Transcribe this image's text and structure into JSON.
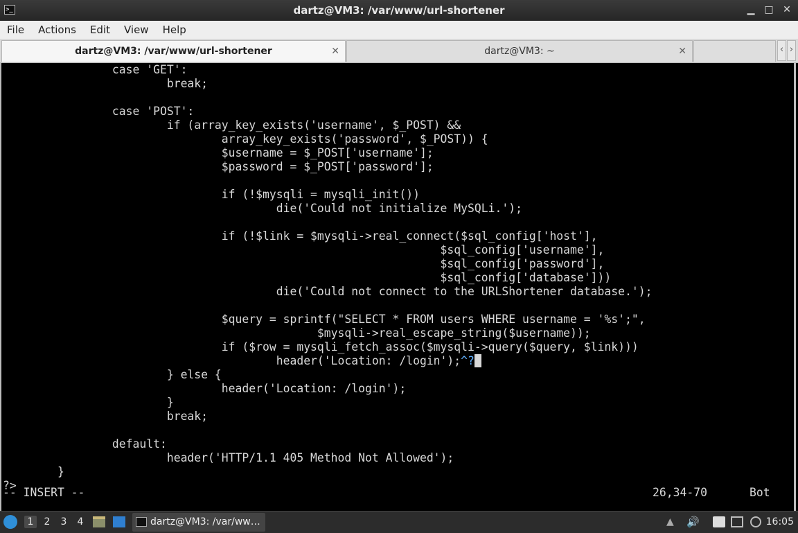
{
  "window": {
    "title": "dartz@VM3: /var/www/url-shortener",
    "app_icon_text": ">_"
  },
  "menu": [
    "File",
    "Actions",
    "Edit",
    "View",
    "Help"
  ],
  "tabs": [
    {
      "label": "dartz@VM3: /var/www/url-shortener",
      "active": true
    },
    {
      "label": "dartz@VM3: ~",
      "active": false
    }
  ],
  "editor": {
    "lines": [
      "                case 'GET':",
      "                        break;",
      "",
      "                case 'POST':",
      "                        if (array_key_exists('username', $_POST) &&",
      "                                array_key_exists('password', $_POST)) {",
      "                                $username = $_POST['username'];",
      "                                $password = $_POST['password'];",
      "",
      "                                if (!$mysqli = mysqli_init())",
      "                                        die('Could not initialize MySQLi.');",
      "",
      "                                if (!$link = $mysqli->real_connect($sql_config['host'],",
      "                                                                $sql_config['username'],",
      "                                                                $sql_config['password'],",
      "                                                                $sql_config['database']))",
      "                                        die('Could not connect to the URLShortener database.');",
      "",
      "                                $query = sprintf(\"SELECT * FROM users WHERE username = '%s';\",",
      "                                              $mysqli->real_escape_string($username));",
      "                                if ($row = mysqli_fetch_assoc($mysqli->query($query, $link)))",
      "                                        header('Location: /login');",
      "                        } else {",
      "                                header('Location: /login');",
      "                        }",
      "                        break;",
      "",
      "                default:",
      "                        header('HTTP/1.1 405 Method Not Allowed');",
      "        }",
      "?>"
    ],
    "control_char": "^?",
    "mode": "-- INSERT --",
    "position": "26,34-70",
    "scroll": "Bot"
  },
  "taskbar": {
    "workspaces": [
      "1",
      "2",
      "3",
      "4"
    ],
    "task_label": "dartz@VM3: /var/ww…",
    "clock": "16:05"
  }
}
